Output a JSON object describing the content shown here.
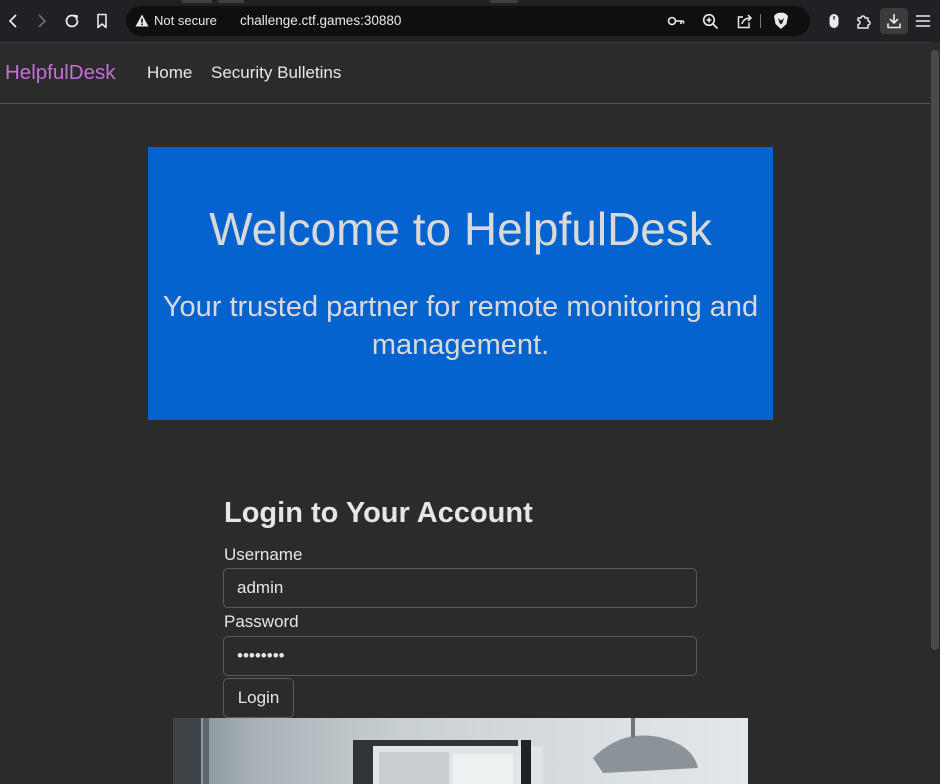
{
  "browser": {
    "security_label": "Not secure",
    "url": "challenge.ctf.games:30880",
    "icons": [
      "back-icon",
      "forward-icon",
      "reload-icon",
      "bookmark-icon",
      "warning-icon",
      "key-icon",
      "zoom-icon",
      "share-icon",
      "brave-shield-icon",
      "mouse-icon",
      "extensions-icon",
      "download-icon",
      "menu-icon"
    ]
  },
  "site": {
    "brand": "HelpfulDesk",
    "nav": {
      "home": "Home",
      "bulletins": "Security Bulletins"
    },
    "brand_color": "#c46fd6"
  },
  "hero": {
    "title": "Welcome to HelpfulDesk",
    "subtitle": "Your trusted partner for remote monitoring and management.",
    "background": "#0563d0"
  },
  "login": {
    "heading": "Login to Your Account",
    "username_label": "Username",
    "username_value": "admin",
    "password_label": "Password",
    "password_value": "••••••••",
    "button_label": "Login"
  },
  "photo": {
    "alt_description_icon": "office-photo"
  }
}
